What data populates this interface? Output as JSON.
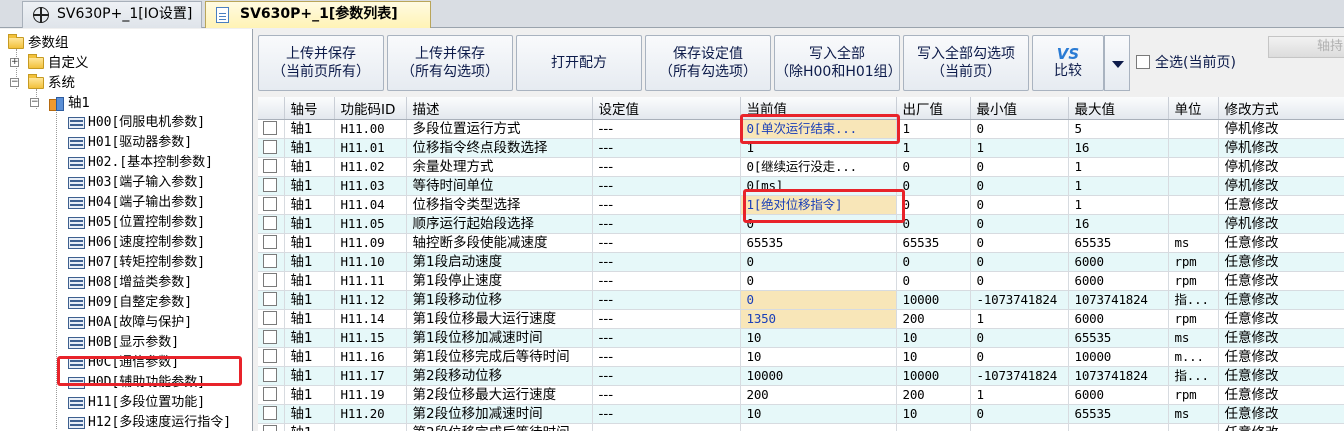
{
  "tabs": [
    {
      "label": "SV630P+_1[IO设置]"
    },
    {
      "label": "SV630P+_1[参数列表]"
    }
  ],
  "tree": {
    "root": "参数组",
    "custom": "自定义",
    "system": "系统",
    "axis": "轴1",
    "groups": [
      "H00[伺服电机参数]",
      "H01[驱动器参数]",
      "H02.[基本控制参数]",
      "H03[端子输入参数]",
      "H04[端子输出参数]",
      "H05[位置控制参数]",
      "H06[速度控制参数]",
      "H07[转矩控制参数]",
      "H08[增益类参数]",
      "H09[自整定参数]",
      "H0A[故障与保护]",
      "H0B[显示参数]",
      "H0C[通信参数]",
      "H0D[辅助功能参数]",
      "H11[多段位置功能]",
      "H12[多段速度运行指令]"
    ]
  },
  "toolbar": {
    "upload_save_page": [
      "上传并保存",
      "（当前页所有）"
    ],
    "upload_save_checked": [
      "上传并保存",
      "（所有勾选项）"
    ],
    "open_recipe": "打开配方",
    "save_setting": [
      "保存设定值",
      "（所有勾选项）"
    ],
    "write_all": [
      "写入全部",
      "（除H00和H01组）"
    ],
    "write_all_checked": [
      "写入全部勾选项",
      "（当前页）"
    ],
    "compare_icon": "VS",
    "compare": "比较",
    "select_all": "全选(当前页)",
    "axis_switch": "轴持"
  },
  "table": {
    "columns": [
      "",
      "轴号",
      "功能码ID",
      "描述",
      "设定值",
      "当前值",
      "出厂值",
      "最小值",
      "最大值",
      "单位",
      "修改方式"
    ],
    "rows": [
      [
        "轴1",
        "H11.00",
        "多段位置运行方式",
        "---",
        "0[单次运行结束...",
        "1",
        "0",
        "5",
        "",
        "停机修改"
      ],
      [
        "轴1",
        "H11.01",
        "位移指令终点段数选择",
        "---",
        "1",
        "1",
        "1",
        "16",
        "",
        "停机修改"
      ],
      [
        "轴1",
        "H11.02",
        "余量处理方式",
        "---",
        "0[继续运行没走...",
        "0",
        "0",
        "1",
        "",
        "停机修改"
      ],
      [
        "轴1",
        "H11.03",
        "等待时间单位",
        "---",
        "0[ms]",
        "0",
        "0",
        "1",
        "",
        "停机修改"
      ],
      [
        "轴1",
        "H11.04",
        "位移指令类型选择",
        "---",
        "1[绝对位移指令]",
        "0",
        "0",
        "1",
        "",
        "任意修改"
      ],
      [
        "轴1",
        "H11.05",
        "顺序运行起始段选择",
        "---",
        "0",
        "0",
        "0",
        "16",
        "",
        "停机修改"
      ],
      [
        "轴1",
        "H11.09",
        "轴控断多段使能减速度",
        "---",
        "65535",
        "65535",
        "0",
        "65535",
        "ms",
        "任意修改"
      ],
      [
        "轴1",
        "H11.10",
        "第1段启动速度",
        "---",
        "0",
        "0",
        "0",
        "6000",
        "rpm",
        "任意修改"
      ],
      [
        "轴1",
        "H11.11",
        "第1段停止速度",
        "---",
        "0",
        "0",
        "0",
        "6000",
        "rpm",
        "任意修改"
      ],
      [
        "轴1",
        "H11.12",
        "第1段移动位移",
        "---",
        "0",
        "10000",
        "-1073741824",
        "1073741824",
        "指...",
        "任意修改"
      ],
      [
        "轴1",
        "H11.14",
        "第1段位移最大运行速度",
        "---",
        "1350",
        "200",
        "1",
        "6000",
        "rpm",
        "任意修改"
      ],
      [
        "轴1",
        "H11.15",
        "第1段位移加减速时间",
        "---",
        "10",
        "10",
        "0",
        "65535",
        "ms",
        "任意修改"
      ],
      [
        "轴1",
        "H11.16",
        "第1段位移完成后等待时间",
        "---",
        "10",
        "10",
        "0",
        "10000",
        "m...",
        "任意修改"
      ],
      [
        "轴1",
        "H11.17",
        "第2段移动位移",
        "---",
        "10000",
        "10000",
        "-1073741824",
        "1073741824",
        "指...",
        "任意修改"
      ],
      [
        "轴1",
        "H11.19",
        "第2段位移最大运行速度",
        "---",
        "200",
        "200",
        "1",
        "6000",
        "rpm",
        "任意修改"
      ],
      [
        "轴1",
        "H11.20",
        "第2段位移加减速时间",
        "---",
        "10",
        "10",
        "0",
        "65535",
        "ms",
        "任意修改"
      ],
      [
        "轴1",
        "",
        "第2段位移完成后等待时间",
        "",
        "",
        "",
        "",
        "",
        "",
        "任意修改"
      ]
    ],
    "edited_rows": [
      0,
      4,
      9,
      10
    ],
    "colors": {
      "edited_bg": "#f8e6b8",
      "edited_text": "#1a3fb8",
      "alt_row": "#e6f8f9",
      "highlight": "#e8232a"
    }
  }
}
